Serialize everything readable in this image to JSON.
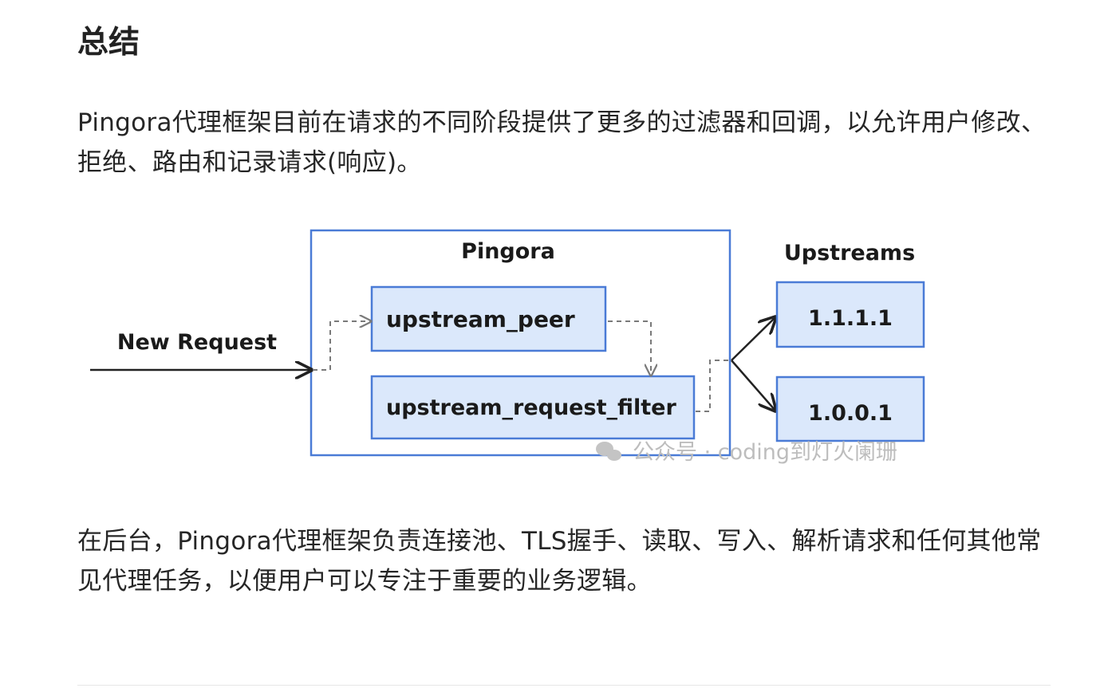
{
  "heading": "总结",
  "paragraph_1": "Pingora代理框架目前在请求的不同阶段提供了更多的过滤器和回调，以允许用户修改、拒绝、路由和记录请求(响应)。",
  "diagram": {
    "new_request": "New Request",
    "pingora": "Pingora",
    "upstream_peer": "upstream_peer",
    "upstream_request_filter": "upstream_request_filter",
    "upstreams": "Upstreams",
    "upstream_1": "1.1.1.1",
    "upstream_2": "1.0.0.1",
    "watermark": "公众号 · coding到灯火阑珊",
    "colors": {
      "box_fill": "#dbe8fb",
      "box_stroke": "#4a7bd6",
      "container_stroke": "#4a7bd6",
      "arrow": "#222222",
      "dashed": "#7a7a7a"
    }
  },
  "paragraph_2": "在后台，Pingora代理框架负责连接池、TLS握手、读取、写入、解析请求和任何其他常见代理任务，以便用户可以专注于重要的业务逻辑。"
}
